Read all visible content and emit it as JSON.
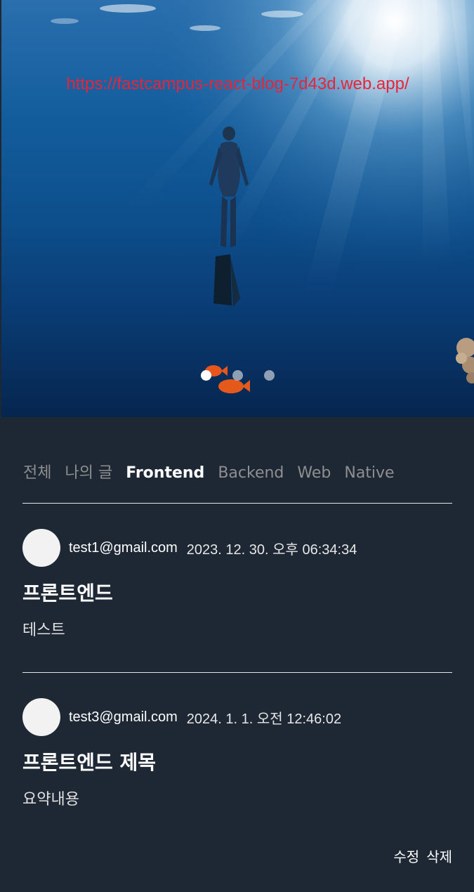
{
  "hero": {
    "url_text": "https://fastcampus-react-blog-7d43d.web.app/",
    "slides": [
      {
        "label": "slide-1",
        "active": true
      },
      {
        "label": "slide-2",
        "active": false
      },
      {
        "label": "slide-3",
        "active": false
      }
    ]
  },
  "tabs": [
    {
      "label": "전체",
      "active": false
    },
    {
      "label": "나의 글",
      "active": false
    },
    {
      "label": "Frontend",
      "active": true
    },
    {
      "label": "Backend",
      "active": false
    },
    {
      "label": "Web",
      "active": false
    },
    {
      "label": "Native",
      "active": false
    }
  ],
  "posts": [
    {
      "email": "test1@gmail.com",
      "date": "2023. 12. 30. 오후 06:34:34",
      "title": "프론트엔드",
      "summary": "테스트"
    },
    {
      "email": "test3@gmail.com",
      "date": "2024. 1. 1. 오전 12:46:02",
      "title": "프론트엔드 제목",
      "summary": "요약내용",
      "actions": {
        "edit": "수정",
        "delete": "삭제"
      }
    }
  ],
  "colors": {
    "background": "#1e2835",
    "url_text": "#e8243a",
    "tab_inactive": "#8f8f8f",
    "tab_active": "#ffffff"
  }
}
